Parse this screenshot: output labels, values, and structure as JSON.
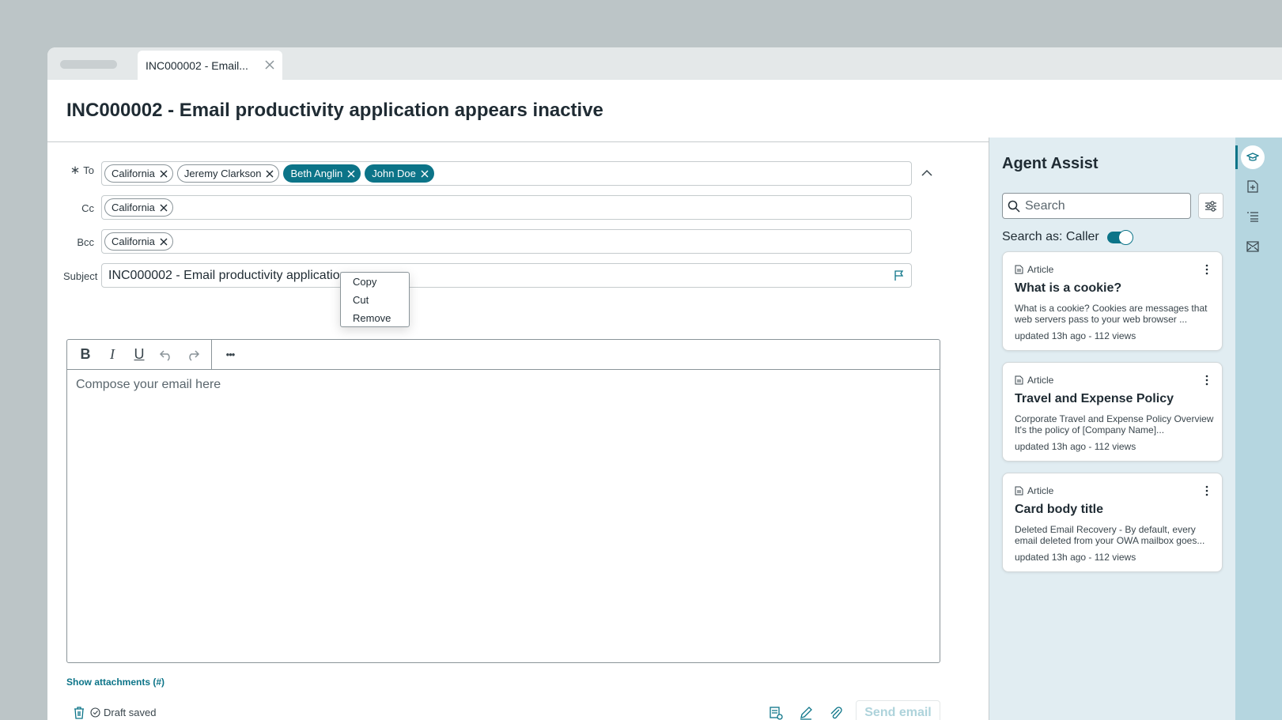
{
  "tab": {
    "label": "INC000002 - Email..."
  },
  "page": {
    "title": "INC000002 - Email productivity application appears inactive"
  },
  "fields": {
    "required_mark": "∗",
    "to_label": "To",
    "cc_label": "Cc",
    "bcc_label": "Bcc",
    "subject_label": "Subject",
    "to_chips": [
      {
        "label": "California",
        "selected": false
      },
      {
        "label": "Jeremy Clarkson",
        "selected": false
      },
      {
        "label": "Beth Anglin",
        "selected": true
      },
      {
        "label": "John Doe",
        "selected": true
      }
    ],
    "cc_chips": [
      {
        "label": "California"
      }
    ],
    "bcc_chips": [
      {
        "label": "California"
      }
    ],
    "subject_value": "INC000002 - Email productivity application"
  },
  "context_menu": {
    "items": [
      "Copy",
      "Cut",
      "Remove"
    ]
  },
  "editor": {
    "toolbar": {
      "bold": "B",
      "italic": "I",
      "underline": "U",
      "more": "•••"
    },
    "placeholder": "Compose your email here"
  },
  "attachments": {
    "link_label": "Show attachments (#)"
  },
  "footer": {
    "draft_status": "Draft saved",
    "send_label": "Send email"
  },
  "agent_assist": {
    "title": "Agent Assist",
    "search_placeholder": "Search",
    "search_as_label": "Search as: Caller",
    "search_as_enabled": true,
    "cards": [
      {
        "type": "Article",
        "title": "What is a cookie?",
        "desc": "What is a cookie? Cookies are messages that web servers pass to your web browser ...",
        "meta": "updated 13h ago - 112 views"
      },
      {
        "type": "Article",
        "title": "Travel and Expense Policy",
        "desc": "Corporate Travel and Expense Policy Overview It's the policy of [Company Name]...",
        "meta": "updated 13h ago - 112 views"
      },
      {
        "type": "Article",
        "title": "Card body title",
        "desc": "Deleted Email Recovery - By default, every email deleted from your OWA mailbox goes...",
        "meta": "updated 13h ago - 112 views"
      }
    ]
  },
  "rail": {
    "icons": [
      "graduation-cap-icon",
      "document-add-icon",
      "list-icon",
      "mail-image-icon"
    ]
  },
  "colors": {
    "accent": "#0c7488",
    "panel_bg": "#e1edf2",
    "rail_bg": "#b5d6e0",
    "send_disabled": "#aed3db"
  }
}
